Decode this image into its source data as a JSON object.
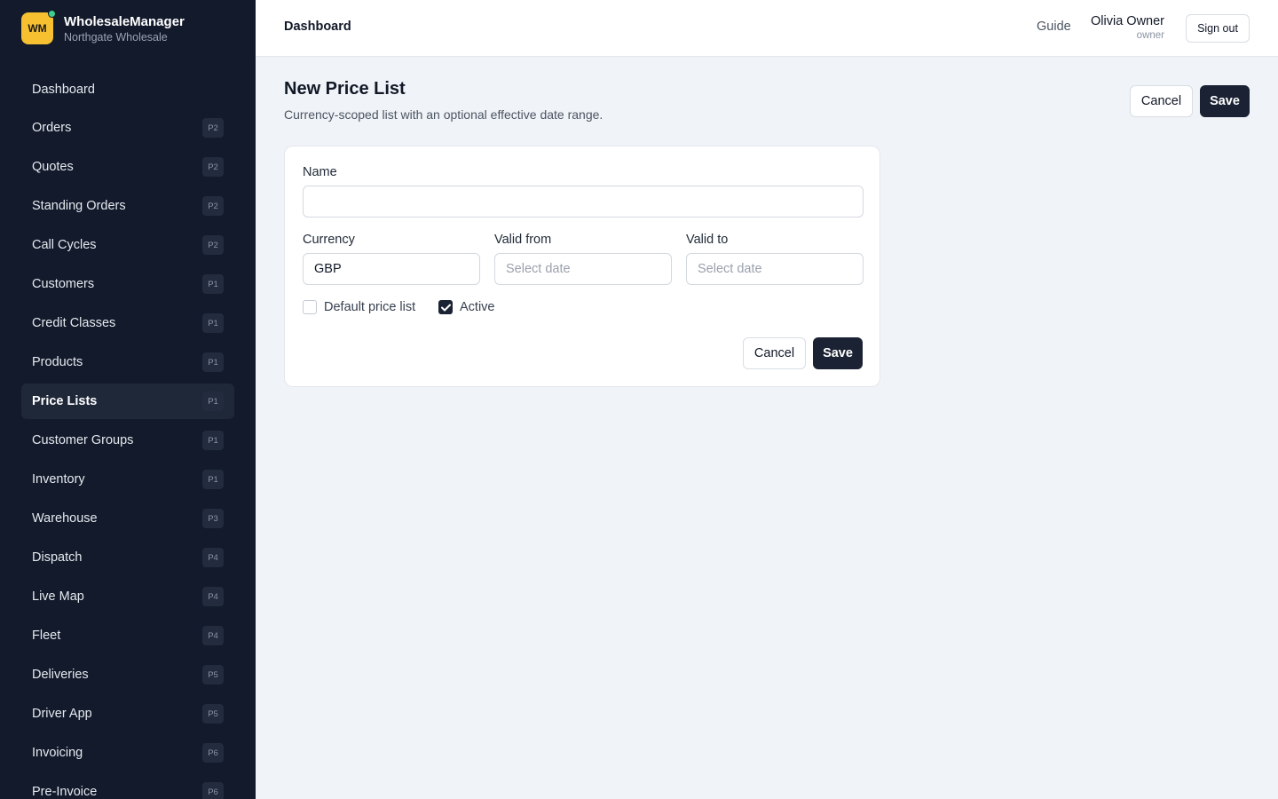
{
  "brand": {
    "logo_text": "WM",
    "name": "WholesaleManager",
    "subtitle": "Northgate Wholesale"
  },
  "sidebar": {
    "items": [
      {
        "label": "Dashboard",
        "badge": ""
      },
      {
        "label": "Orders",
        "badge": "P2"
      },
      {
        "label": "Quotes",
        "badge": "P2"
      },
      {
        "label": "Standing Orders",
        "badge": "P2"
      },
      {
        "label": "Call Cycles",
        "badge": "P2"
      },
      {
        "label": "Customers",
        "badge": "P1"
      },
      {
        "label": "Credit Classes",
        "badge": "P1"
      },
      {
        "label": "Products",
        "badge": "P1"
      },
      {
        "label": "Price Lists",
        "badge": "P1",
        "active": true
      },
      {
        "label": "Customer Groups",
        "badge": "P1"
      },
      {
        "label": "Inventory",
        "badge": "P1"
      },
      {
        "label": "Warehouse",
        "badge": "P3"
      },
      {
        "label": "Dispatch",
        "badge": "P4"
      },
      {
        "label": "Live Map",
        "badge": "P4"
      },
      {
        "label": "Fleet",
        "badge": "P4"
      },
      {
        "label": "Deliveries",
        "badge": "P5"
      },
      {
        "label": "Driver App",
        "badge": "P5"
      },
      {
        "label": "Invoicing",
        "badge": "P6"
      },
      {
        "label": "Pre-Invoice",
        "badge": "P6"
      }
    ]
  },
  "topbar": {
    "title": "Dashboard",
    "guide": "Guide",
    "user_name": "Olivia Owner",
    "user_role": "owner",
    "signout": "Sign out"
  },
  "page": {
    "title": "New Price List",
    "subtitle": "Currency-scoped list with an optional effective date range.",
    "cancel": "Cancel",
    "save": "Save"
  },
  "form": {
    "name_label": "Name",
    "name_value": "",
    "currency_label": "Currency",
    "currency_value": "GBP",
    "valid_from_label": "Valid from",
    "valid_from_placeholder": "Select date",
    "valid_to_label": "Valid to",
    "valid_to_placeholder": "Select date",
    "default_label": "Default price list",
    "default_checked": false,
    "active_label": "Active",
    "active_checked": true,
    "cancel": "Cancel",
    "save": "Save"
  },
  "colors": {
    "sidebar_bg": "#121a2b",
    "accent": "#f6c030",
    "primary_button": "#1a2233",
    "page_bg": "#f0f3f7"
  }
}
